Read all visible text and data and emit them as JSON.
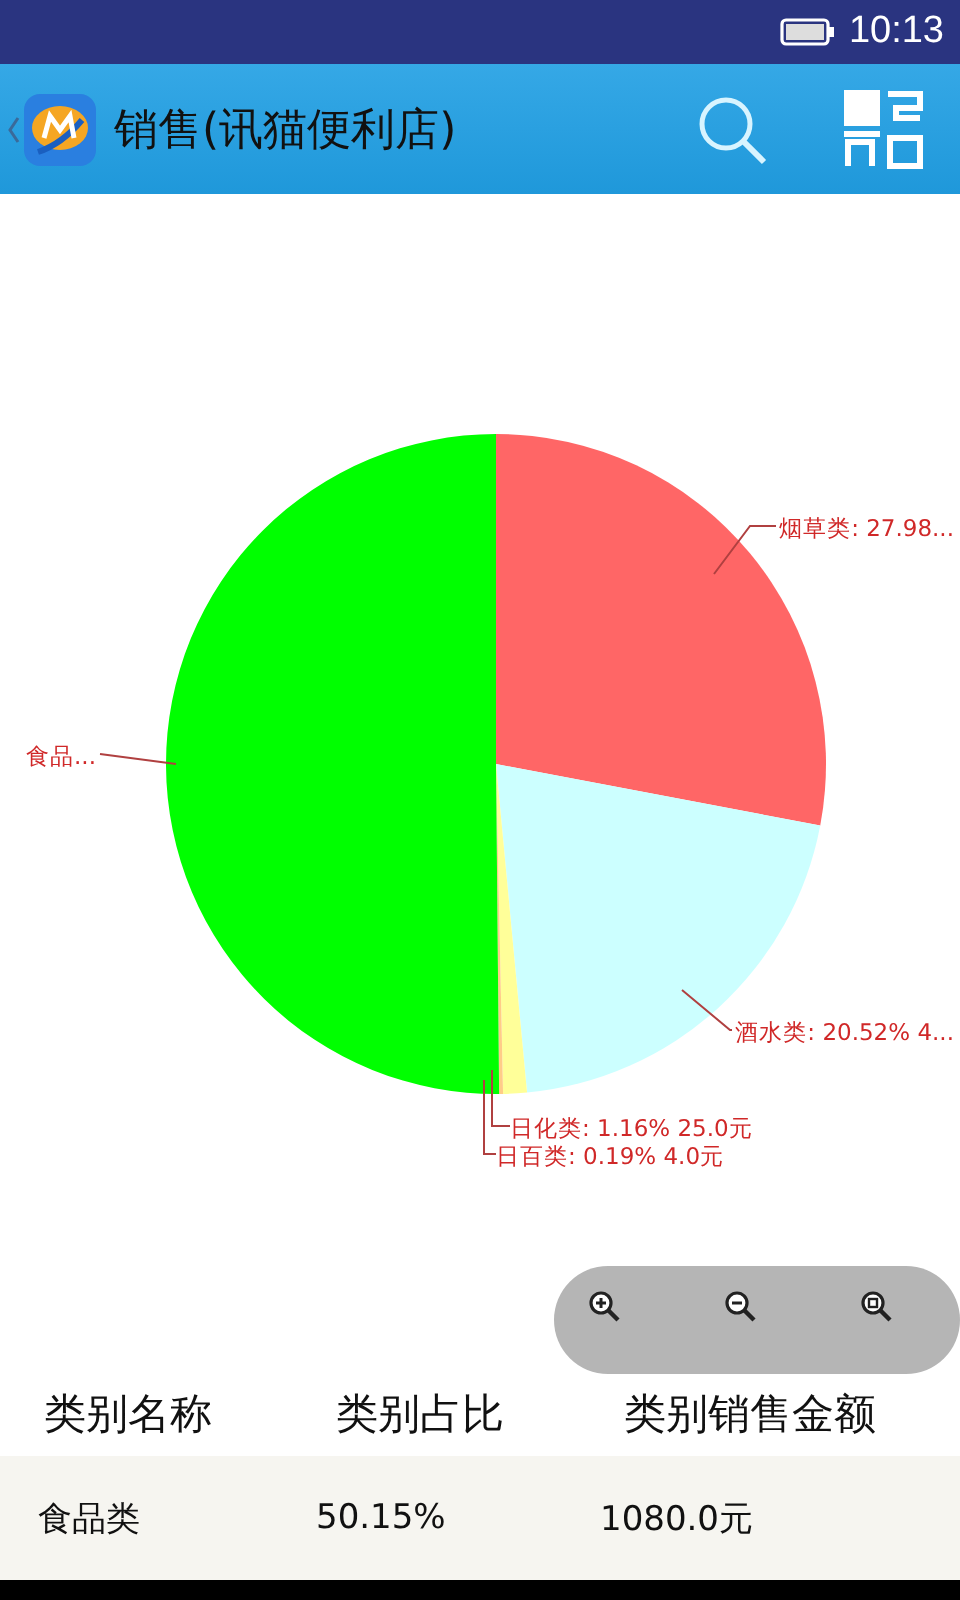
{
  "status_bar": {
    "time": "10:13"
  },
  "app_bar": {
    "title": "销售(讯猫便利店)"
  },
  "chart": {
    "chart_data": {
      "type": "pie",
      "values": [
        27.98,
        20.52,
        1.16,
        0.19,
        50.15
      ]
    },
    "slices": [
      {
        "label": "烟草类: 27.98...",
        "color": "#ff6666"
      },
      {
        "label": "酒水类: 20.52% 4...",
        "color": "#ccffff"
      },
      {
        "label": "日化类: 1.16% 25.0元",
        "color": "#ffff99"
      },
      {
        "label": "日百类: 0.19% 4.0元",
        "color": "#ffcc88"
      },
      {
        "label": "食品...",
        "color": "#00ff00"
      }
    ]
  },
  "table": {
    "columns": [
      "类别名称",
      "类别占比",
      "类别销售金额"
    ],
    "rows": [
      [
        "食品类",
        "50.15%",
        "1080.0元"
      ]
    ]
  }
}
